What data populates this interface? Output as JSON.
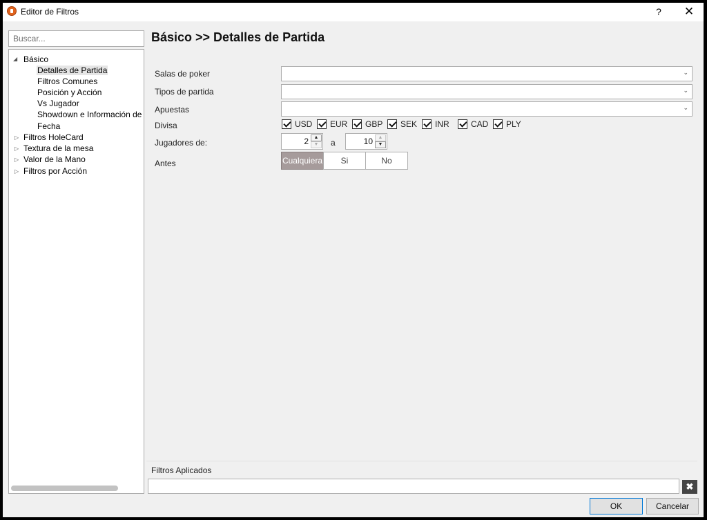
{
  "window": {
    "title": "Editor de Filtros",
    "help_glyph": "?",
    "close_glyph": "✕"
  },
  "sidebar": {
    "search_placeholder": "Buscar...",
    "tree": [
      {
        "label": "Básico",
        "expanded": true
      },
      {
        "label": "Detalles de Partida",
        "selected": true
      },
      {
        "label": "Filtros Comunes"
      },
      {
        "label": "Posición y Acción"
      },
      {
        "label": "Vs Jugador"
      },
      {
        "label": "Showdown e Información de"
      },
      {
        "label": "Fecha"
      },
      {
        "label": "Filtros HoleCard",
        "expanded": false
      },
      {
        "label": "Textura de la mesa",
        "expanded": false
      },
      {
        "label": "Valor de la Mano",
        "expanded": false
      },
      {
        "label": "Filtros por Acción",
        "expanded": false
      }
    ]
  },
  "main": {
    "title": "Básico >> Detalles de Partida",
    "labels": {
      "salas": "Salas de poker",
      "tipos": "Tipos de partida",
      "apuestas": "Apuestas",
      "divisa": "Divisa",
      "jugadores": "Jugadores de:",
      "antes": "Antes"
    },
    "currencies": [
      {
        "label": "USD",
        "checked": true
      },
      {
        "label": "EUR",
        "checked": true
      },
      {
        "label": "GBP",
        "checked": true
      },
      {
        "label": "SEK",
        "checked": true
      },
      {
        "label": "INR",
        "checked": true
      },
      {
        "label": "CAD",
        "checked": true
      },
      {
        "label": "PLY",
        "checked": true
      }
    ],
    "players_min": "2",
    "players_to": "a",
    "players_max": "10",
    "antes_options": [
      "Cualquiera",
      "Si",
      "No"
    ],
    "antes_selected": "Cualquiera",
    "antes_active_color": "#a69b9b"
  },
  "footer": {
    "applied_label": "Filtros Aplicados",
    "clear_glyph": "✖",
    "ok_label": "OK",
    "cancel_label": "Cancelar"
  }
}
